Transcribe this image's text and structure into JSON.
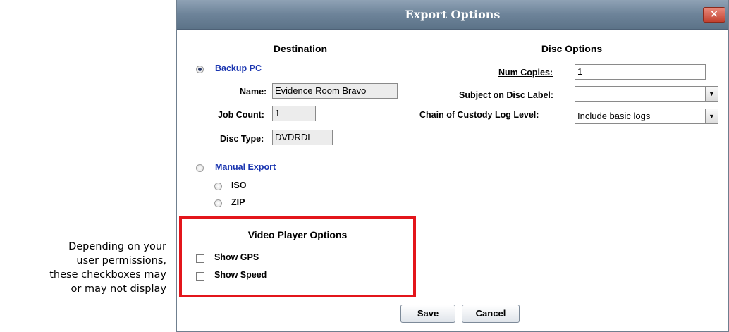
{
  "callout": {
    "lines": [
      "Depending on your",
      "user permissions,",
      "these checkboxes may",
      "or may not display"
    ]
  },
  "dialog": {
    "title": "Export Options",
    "close_glyph": "×"
  },
  "destination": {
    "heading": "Destination",
    "backup_pc": {
      "label": "Backup PC",
      "selected": true,
      "name_label": "Name:",
      "name_value": "Evidence Room Bravo",
      "job_count_label": "Job Count:",
      "job_count_value": "1",
      "disc_type_label": "Disc Type:",
      "disc_type_value": "DVDRDL"
    },
    "manual_export": {
      "label": "Manual Export",
      "selected": false,
      "iso_label": "ISO",
      "zip_label": "ZIP"
    }
  },
  "disc_options": {
    "heading": "Disc Options",
    "num_copies_label": "Num Copies:",
    "num_copies_value": "1",
    "subject_label": "Subject on Disc Label:",
    "subject_value": "",
    "custody_label": "Chain of Custody Log Level:",
    "custody_value": "Include basic logs"
  },
  "video_player": {
    "heading": "Video Player Options",
    "show_gps_label": "Show GPS",
    "show_speed_label": "Show Speed"
  },
  "buttons": {
    "save": "Save",
    "cancel": "Cancel"
  },
  "colors": {
    "highlight_box": "#e3151b",
    "link_text": "#1a35b0",
    "titlebar": "#6d8399"
  },
  "icons": {
    "dropdown": "▼"
  }
}
